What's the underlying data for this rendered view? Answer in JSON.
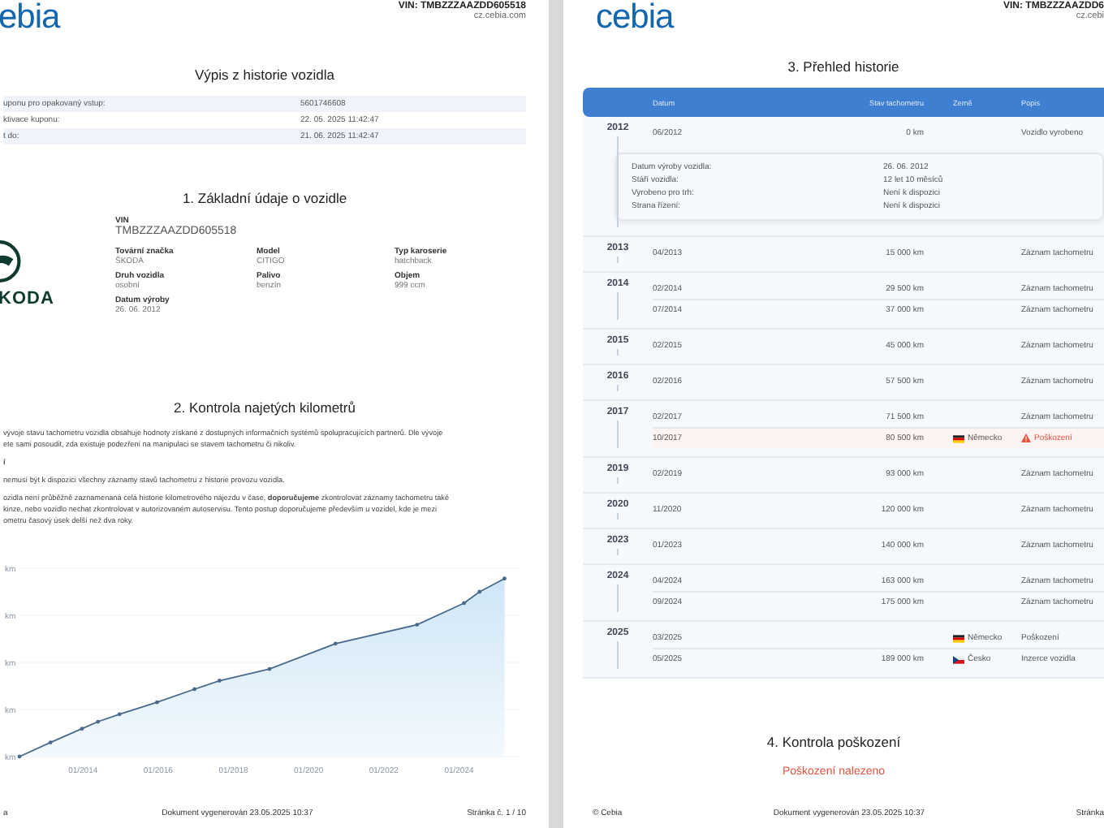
{
  "left_page": {
    "logo": "ebia",
    "vin": "VIN: TMBZZZAAZDD605518",
    "site": "cz.cebia.com",
    "title": "Výpis z historie vozidla",
    "coupon_rows": [
      {
        "label": "uponu pro opakovaný vstup:",
        "value": "5601746608"
      },
      {
        "label": "ktivace kuponu:",
        "value": "22. 05. 2025 11:42:47"
      },
      {
        "label": "t do:",
        "value": "21. 06. 2025 11:42:47"
      }
    ],
    "section_1": {
      "title": "1. Základní údaje o vozidle",
      "brand_logo_text": "KODA",
      "vin_label": "VIN",
      "vin": "TMBZZZAAZDD605518",
      "fields": [
        {
          "label": "Tovární značka",
          "value": "ŠKODA"
        },
        {
          "label": "Model",
          "value": "CITIGO"
        },
        {
          "label": "Typ karoserie",
          "value": "hatchback"
        },
        {
          "label": "Druh vozidla",
          "value": "osobní"
        },
        {
          "label": "Palivo",
          "value": "benzín"
        },
        {
          "label": "Objem",
          "value": "999 ccm"
        },
        {
          "label": "Datum výroby",
          "value": "26. 06. 2012"
        }
      ]
    },
    "section_2": {
      "title": "2. Kontrola najetých kilometrů",
      "paragraphs": [
        {
          "kind": "text",
          "lines": [
            "vývoje stavu tachometru vozidla obsahuje hodnoty získané z dostupných informačních systémů spolupracujících partnerů. Dle vývoje",
            "ete sami posoudit, zda existuje podezření na manipulaci se stavem tachometru či nikoliv."
          ]
        },
        {
          "kind": "heading",
          "lines": [
            "í"
          ]
        },
        {
          "kind": "text",
          "lines": [
            "nemusí být k dispozici všechny záznamy stavů tachometru z historie provozu vozidla."
          ]
        },
        {
          "kind": "text",
          "lines": [
            "ozidla není průběžně zaznamenaná celá historie kilometrového nájezdu v čase, **doporučujeme** zkontrolovat záznamy tachometru také",
            "kinze, nebo vozidlo nechat zkontrolovat v autorizovaném autoservisu. Tento postup doporučujeme především u vozidel, kde je mezi",
            "ometru časový úsek delší než dva roky."
          ]
        }
      ],
      "chart": {
        "y_axis_labels": [
          "km",
          "km",
          "km",
          "km",
          "km"
        ],
        "x_axis_labels": [
          "01/2014",
          "01/2016",
          "01/2018",
          "01/2020",
          "01/2022",
          "01/2024"
        ]
      }
    },
    "footer": {
      "left": "a",
      "center": "Dokument vygenerován 23.05.2025 10:37",
      "right": "Stránka č. 1 / 10"
    }
  },
  "right_page": {
    "logo": "cebia",
    "vin": "VIN: TMBZZZAAZDD6",
    "site": "cz.cebi",
    "title": "3. Přehled historie",
    "columns": [
      "Datum",
      "Stav tachometru",
      "Země",
      "Popis"
    ],
    "groups": [
      {
        "year": "2012",
        "rows": [
          {
            "date": "06/2012",
            "km": "0 km",
            "description": "Vozidlo vyrobeno",
            "alert": false
          }
        ],
        "details": [
          {
            "label": "Datum výroby vozidla:",
            "value": "26. 06. 2012"
          },
          {
            "label": "Stáří vozidla:",
            "value": "12 let 10 měsíců"
          },
          {
            "label": "Vyrobeno pro trh:",
            "value": "Není k dispozici"
          },
          {
            "label": "Strana řízení:",
            "value": "Není k dispozici"
          }
        ]
      },
      {
        "year": "2013",
        "rows": [
          {
            "date": "04/2013",
            "km": "15 000 km",
            "description": "Záznam tachometru",
            "alert": false
          }
        ]
      },
      {
        "year": "2014",
        "rows": [
          {
            "date": "02/2014",
            "km": "29 500 km",
            "description": "Záznam tachometru",
            "alert": false
          },
          {
            "date": "07/2014",
            "km": "37 000 km",
            "description": "Záznam tachometru",
            "alert": false
          }
        ]
      },
      {
        "year": "2015",
        "rows": [
          {
            "date": "02/2015",
            "km": "45 000 km",
            "description": "Záznam tachometru",
            "alert": false
          }
        ]
      },
      {
        "year": "2016",
        "rows": [
          {
            "date": "02/2016",
            "km": "57 500 km",
            "description": "Záznam tachometru",
            "alert": false
          }
        ]
      },
      {
        "year": "2017",
        "rows": [
          {
            "date": "02/2017",
            "km": "71 500 km",
            "description": "Záznam tachometru",
            "alert": false
          },
          {
            "date": "10/2017",
            "km": "80 500 km",
            "kind": "german-flag",
            "country": "Německo",
            "description": "Poškození",
            "alert": true
          }
        ]
      },
      {
        "year": "2019",
        "rows": [
          {
            "date": "02/2019",
            "km": "93 000 km",
            "description": "Záznam tachometru",
            "alert": false
          }
        ]
      },
      {
        "year": "2020",
        "rows": [
          {
            "date": "11/2020",
            "km": "120 000 km",
            "description": "Záznam tachometru",
            "alert": false
          }
        ]
      },
      {
        "year": "2023",
        "rows": [
          {
            "date": "01/2023",
            "km": "140 000 km",
            "description": "Záznam tachometru",
            "alert": false
          }
        ]
      },
      {
        "year": "2024",
        "rows": [
          {
            "date": "04/2024",
            "km": "163 000 km",
            "description": "Záznam tachometru",
            "alert": false
          },
          {
            "date": "09/2024",
            "km": "175 000 km",
            "description": "Záznam tachometru",
            "alert": false
          }
        ]
      },
      {
        "year": "2025",
        "rows": [
          {
            "date": "03/2025",
            "kind": "german-flag",
            "country": "Německo",
            "description": "Poškození",
            "alert": false
          },
          {
            "date": "05/2025",
            "km": "189 000 km",
            "kind": "czech-flag",
            "country": "Česko",
            "description": "Inzerce vozidla",
            "alert": false
          }
        ]
      }
    ],
    "section_4": {
      "title": "4. Kontrola poškození",
      "result": "Poškození nalezeno",
      "damage_found": true
    },
    "footer": {
      "left": "© Cebia",
      "center": "Dokument vygenerován 23.05.2025 10:37",
      "right": "Stránka"
    }
  }
}
